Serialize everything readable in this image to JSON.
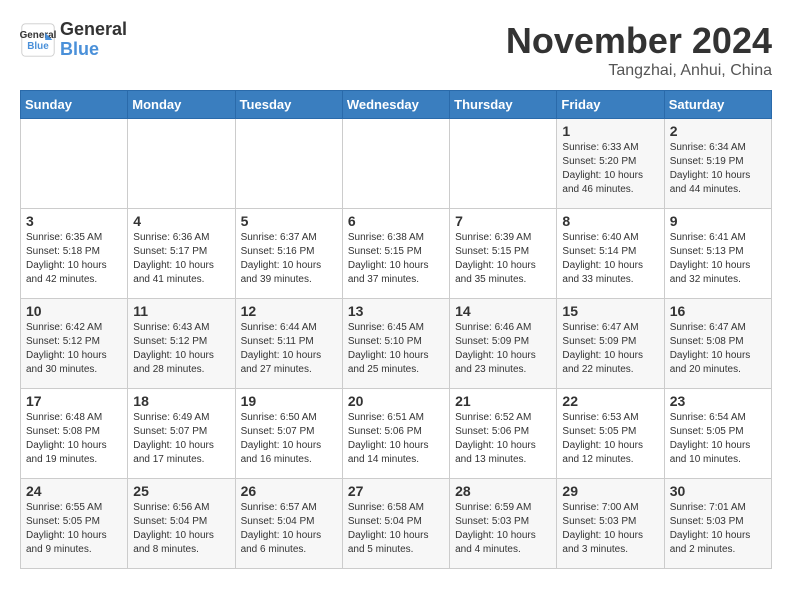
{
  "logo": {
    "line1": "General",
    "line2": "Blue"
  },
  "title": "November 2024",
  "subtitle": "Tangzhai, Anhui, China",
  "headers": [
    "Sunday",
    "Monday",
    "Tuesday",
    "Wednesday",
    "Thursday",
    "Friday",
    "Saturday"
  ],
  "weeks": [
    [
      {
        "day": "",
        "info": ""
      },
      {
        "day": "",
        "info": ""
      },
      {
        "day": "",
        "info": ""
      },
      {
        "day": "",
        "info": ""
      },
      {
        "day": "",
        "info": ""
      },
      {
        "day": "1",
        "info": "Sunrise: 6:33 AM\nSunset: 5:20 PM\nDaylight: 10 hours\nand 46 minutes."
      },
      {
        "day": "2",
        "info": "Sunrise: 6:34 AM\nSunset: 5:19 PM\nDaylight: 10 hours\nand 44 minutes."
      }
    ],
    [
      {
        "day": "3",
        "info": "Sunrise: 6:35 AM\nSunset: 5:18 PM\nDaylight: 10 hours\nand 42 minutes."
      },
      {
        "day": "4",
        "info": "Sunrise: 6:36 AM\nSunset: 5:17 PM\nDaylight: 10 hours\nand 41 minutes."
      },
      {
        "day": "5",
        "info": "Sunrise: 6:37 AM\nSunset: 5:16 PM\nDaylight: 10 hours\nand 39 minutes."
      },
      {
        "day": "6",
        "info": "Sunrise: 6:38 AM\nSunset: 5:15 PM\nDaylight: 10 hours\nand 37 minutes."
      },
      {
        "day": "7",
        "info": "Sunrise: 6:39 AM\nSunset: 5:15 PM\nDaylight: 10 hours\nand 35 minutes."
      },
      {
        "day": "8",
        "info": "Sunrise: 6:40 AM\nSunset: 5:14 PM\nDaylight: 10 hours\nand 33 minutes."
      },
      {
        "day": "9",
        "info": "Sunrise: 6:41 AM\nSunset: 5:13 PM\nDaylight: 10 hours\nand 32 minutes."
      }
    ],
    [
      {
        "day": "10",
        "info": "Sunrise: 6:42 AM\nSunset: 5:12 PM\nDaylight: 10 hours\nand 30 minutes."
      },
      {
        "day": "11",
        "info": "Sunrise: 6:43 AM\nSunset: 5:12 PM\nDaylight: 10 hours\nand 28 minutes."
      },
      {
        "day": "12",
        "info": "Sunrise: 6:44 AM\nSunset: 5:11 PM\nDaylight: 10 hours\nand 27 minutes."
      },
      {
        "day": "13",
        "info": "Sunrise: 6:45 AM\nSunset: 5:10 PM\nDaylight: 10 hours\nand 25 minutes."
      },
      {
        "day": "14",
        "info": "Sunrise: 6:46 AM\nSunset: 5:09 PM\nDaylight: 10 hours\nand 23 minutes."
      },
      {
        "day": "15",
        "info": "Sunrise: 6:47 AM\nSunset: 5:09 PM\nDaylight: 10 hours\nand 22 minutes."
      },
      {
        "day": "16",
        "info": "Sunrise: 6:47 AM\nSunset: 5:08 PM\nDaylight: 10 hours\nand 20 minutes."
      }
    ],
    [
      {
        "day": "17",
        "info": "Sunrise: 6:48 AM\nSunset: 5:08 PM\nDaylight: 10 hours\nand 19 minutes."
      },
      {
        "day": "18",
        "info": "Sunrise: 6:49 AM\nSunset: 5:07 PM\nDaylight: 10 hours\nand 17 minutes."
      },
      {
        "day": "19",
        "info": "Sunrise: 6:50 AM\nSunset: 5:07 PM\nDaylight: 10 hours\nand 16 minutes."
      },
      {
        "day": "20",
        "info": "Sunrise: 6:51 AM\nSunset: 5:06 PM\nDaylight: 10 hours\nand 14 minutes."
      },
      {
        "day": "21",
        "info": "Sunrise: 6:52 AM\nSunset: 5:06 PM\nDaylight: 10 hours\nand 13 minutes."
      },
      {
        "day": "22",
        "info": "Sunrise: 6:53 AM\nSunset: 5:05 PM\nDaylight: 10 hours\nand 12 minutes."
      },
      {
        "day": "23",
        "info": "Sunrise: 6:54 AM\nSunset: 5:05 PM\nDaylight: 10 hours\nand 10 minutes."
      }
    ],
    [
      {
        "day": "24",
        "info": "Sunrise: 6:55 AM\nSunset: 5:05 PM\nDaylight: 10 hours\nand 9 minutes."
      },
      {
        "day": "25",
        "info": "Sunrise: 6:56 AM\nSunset: 5:04 PM\nDaylight: 10 hours\nand 8 minutes."
      },
      {
        "day": "26",
        "info": "Sunrise: 6:57 AM\nSunset: 5:04 PM\nDaylight: 10 hours\nand 6 minutes."
      },
      {
        "day": "27",
        "info": "Sunrise: 6:58 AM\nSunset: 5:04 PM\nDaylight: 10 hours\nand 5 minutes."
      },
      {
        "day": "28",
        "info": "Sunrise: 6:59 AM\nSunset: 5:03 PM\nDaylight: 10 hours\nand 4 minutes."
      },
      {
        "day": "29",
        "info": "Sunrise: 7:00 AM\nSunset: 5:03 PM\nDaylight: 10 hours\nand 3 minutes."
      },
      {
        "day": "30",
        "info": "Sunrise: 7:01 AM\nSunset: 5:03 PM\nDaylight: 10 hours\nand 2 minutes."
      }
    ]
  ]
}
